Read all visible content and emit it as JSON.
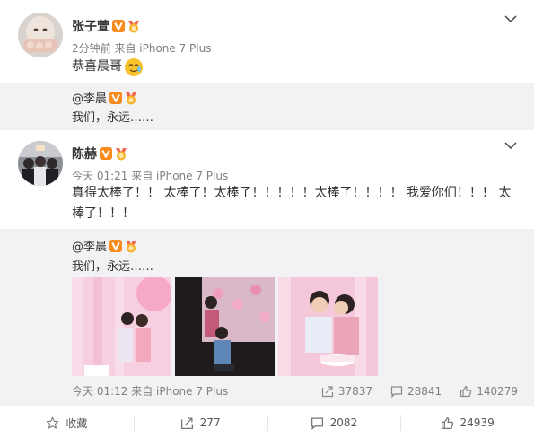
{
  "post1": {
    "username": "张子萱",
    "meta": "2分钟前 来自 iPhone 7 Plus",
    "content": "恭喜晨哥",
    "quote": {
      "username": "@李晨",
      "text": "我们，永远……"
    }
  },
  "post2": {
    "username": "陈赫",
    "meta": "今天 01:21 来自 iPhone 7 Plus",
    "content_line1": "真得太棒了！！ 太棒了！太棒了！！！！！太棒了！！！！ 我爱你们！！！ 太",
    "content_line2": "棒了！！！",
    "quote": {
      "username": "@李晨",
      "text": "我们，永远……",
      "time": "今天 01:12 来自 iPhone 7 Plus",
      "reposts": "37837",
      "comments": "28841",
      "likes": "140279"
    },
    "actions": {
      "favorite": "收藏",
      "repost": "277",
      "comment": "2082",
      "like": "24939"
    }
  },
  "colors": {
    "badge_orange": "#f78b1f",
    "meta_gray": "#808080",
    "quote_bg": "#f2f2f5"
  },
  "icons": [
    "chevron-down-icon",
    "verified-v-icon",
    "medal-icon",
    "repost-icon",
    "comment-icon",
    "like-icon",
    "star-icon",
    "emoji-icon"
  ]
}
